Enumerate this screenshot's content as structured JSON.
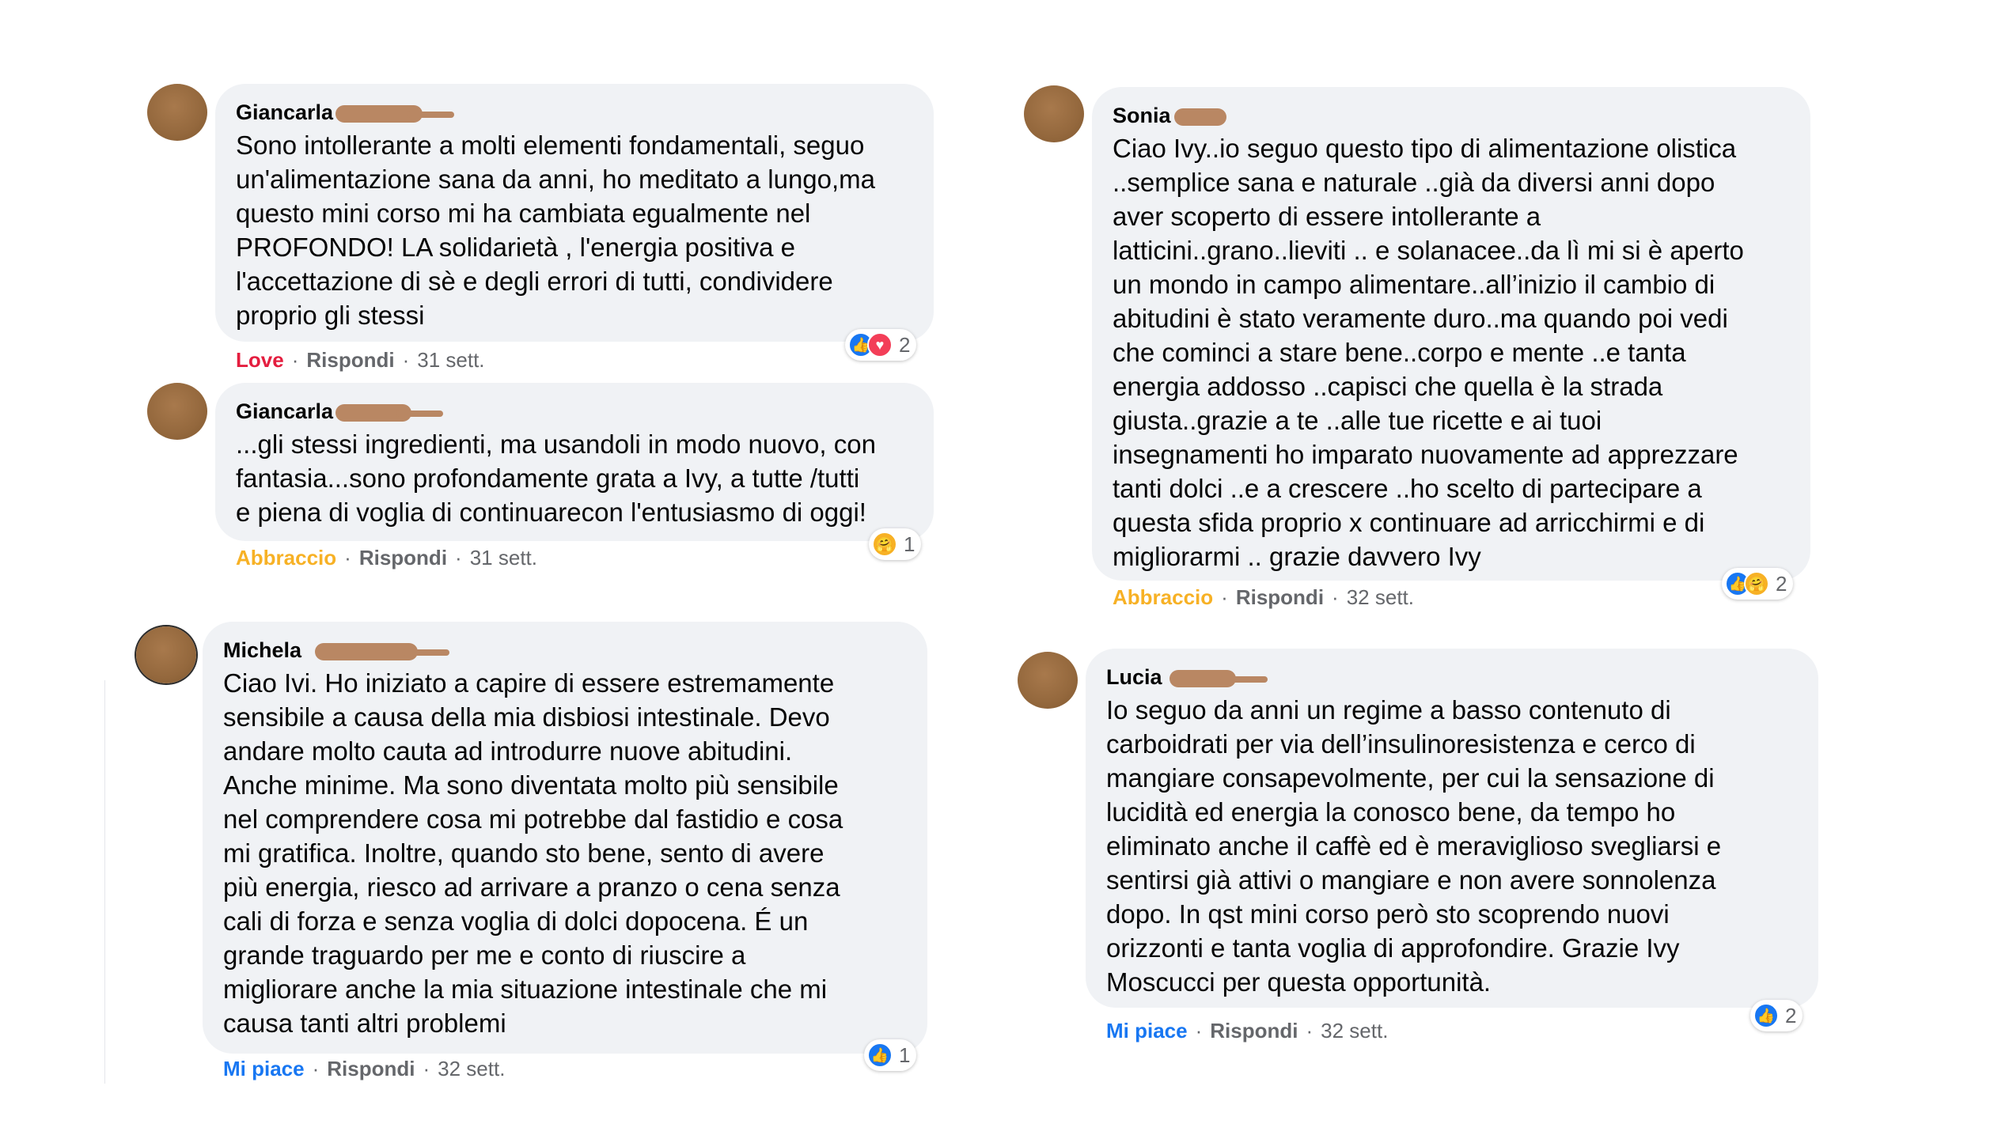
{
  "comments": [
    {
      "author": "Giancarla",
      "lines": [
        "Sono intollerante a molti elementi fondamentali, seguo",
        "un'alimentazione sana da anni, ho meditato a lungo,ma",
        "questo mini corso mi ha cambiata egualmente nel",
        "PROFONDO! LA solidarietà , l'energia positiva e",
        "l'accettazione di sè e degli errori di tutti, condividere",
        "proprio gli stessi"
      ],
      "reaction_label": "Love",
      "reply_label": "Rispondi",
      "time": "31 sett.",
      "reaction_icons": [
        "like-icon",
        "love-icon"
      ],
      "reaction_count": "2"
    },
    {
      "author": "Giancarla",
      "lines": [
        "...gli stessi ingredienti, ma usandoli in modo nuovo, con",
        "fantasia...sono profondamente grata a Ivy, a tutte /tutti",
        "e piena di voglia di continuarecon l'entusiasmo di oggi!"
      ],
      "reaction_label": "Abbraccio",
      "reply_label": "Rispondi",
      "time": "31 sett.",
      "reaction_icons": [
        "hug-icon"
      ],
      "reaction_count": "1"
    },
    {
      "author": "Michela",
      "lines": [
        "Ciao Ivi. Ho iniziato a capire di essere estremamente",
        "sensibile a causa della mia disbiosi intestinale. Devo",
        "andare molto cauta ad introdurre nuove abitudini.",
        "Anche minime. Ma sono diventata molto più sensibile",
        "nel comprendere cosa mi potrebbe dal fastidio e cosa",
        "mi gratifica. Inoltre, quando sto bene, sento di avere",
        "più energia, riesco ad arrivare a pranzo o cena senza",
        "cali di forza e senza voglia di dolci dopocena. É un",
        "grande traguardo per me e conto di riuscire a",
        "migliorare anche la mia situazione intestinale che mi",
        "causa tanti altri problemi"
      ],
      "reaction_label": "Mi piace",
      "reply_label": "Rispondi",
      "time": "32 sett.",
      "reaction_icons": [
        "like-icon"
      ],
      "reaction_count": "1"
    },
    {
      "author": "Sonia",
      "lines": [
        "Ciao Ivy..io seguo questo tipo di alimentazione olistica",
        "..semplice sana e naturale ..già da diversi anni dopo",
        "aver scoperto di essere intollerante a",
        "latticini..grano..lieviti .. e solanacee..da lì mi si è aperto",
        "un mondo in campo alimentare..all’inizio il cambio di",
        "abitudini è stato veramente duro..ma quando poi vedi",
        "che cominci a stare bene..corpo e mente ..e tanta",
        "energia addosso ..capisci che quella è la strada",
        "giusta..grazie a te ..alle tue ricette e ai tuoi",
        "insegnamenti ho imparato nuovamente ad apprezzare",
        "tanti dolci ..e a crescere ..ho scelto di partecipare a",
        "questa sfida proprio x continuare ad arricchirmi e di",
        "migliorarmi .. grazie davvero Ivy"
      ],
      "reaction_label": "Abbraccio",
      "reply_label": "Rispondi",
      "time": "32 sett.",
      "reaction_icons": [
        "like-icon",
        "hug-icon"
      ],
      "reaction_count": "2"
    },
    {
      "author": "Lucia",
      "lines": [
        "Io seguo da anni un regime a basso contenuto di",
        "carboidrati per via dell’insulinoresistenza e cerco di",
        "mangiare consapevolmente, per cui la sensazione di",
        "lucidità ed energia la conosco bene, da tempo ho",
        "eliminato anche il caffè ed è meraviglioso svegliarsi e",
        "sentirsi già attivi o mangiare e non avere sonnolenza",
        "dopo. In qst mini corso però sto scoprendo nuovi",
        "orizzonti e tanta voglia di approfondire. Grazie Ivy",
        "Moscucci per questa opportunità."
      ],
      "reaction_label": "Mi piace",
      "reply_label": "Rispondi",
      "time": "32 sett.",
      "reaction_icons": [
        "like-icon"
      ],
      "reaction_count": "2"
    }
  ]
}
